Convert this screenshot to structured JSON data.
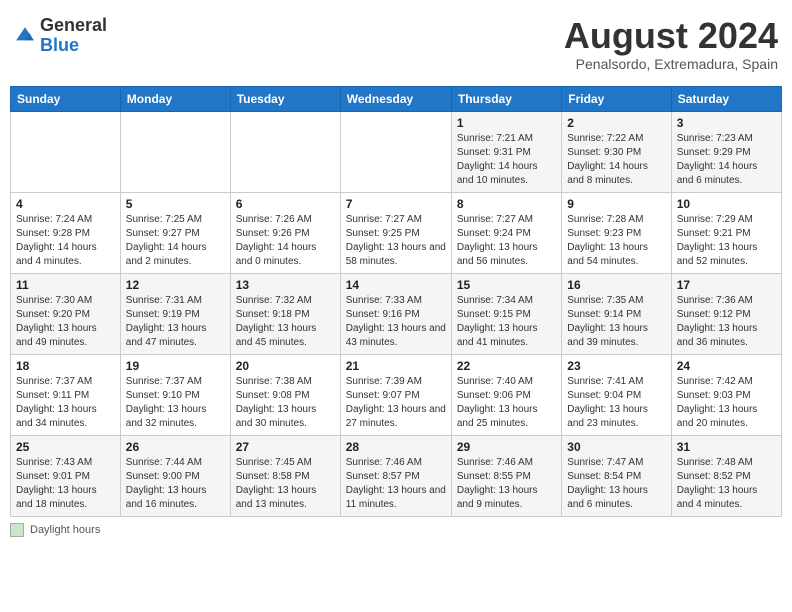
{
  "header": {
    "logo_general": "General",
    "logo_blue": "Blue",
    "month_title": "August 2024",
    "location": "Penalsordo, Extremadura, Spain"
  },
  "footer": {
    "box_label": "Daylight hours"
  },
  "days_of_week": [
    "Sunday",
    "Monday",
    "Tuesday",
    "Wednesday",
    "Thursday",
    "Friday",
    "Saturday"
  ],
  "weeks": [
    {
      "days": [
        {
          "number": "",
          "info": ""
        },
        {
          "number": "",
          "info": ""
        },
        {
          "number": "",
          "info": ""
        },
        {
          "number": "",
          "info": ""
        },
        {
          "number": "1",
          "info": "Sunrise: 7:21 AM\nSunset: 9:31 PM\nDaylight: 14 hours and 10 minutes."
        },
        {
          "number": "2",
          "info": "Sunrise: 7:22 AM\nSunset: 9:30 PM\nDaylight: 14 hours and 8 minutes."
        },
        {
          "number": "3",
          "info": "Sunrise: 7:23 AM\nSunset: 9:29 PM\nDaylight: 14 hours and 6 minutes."
        }
      ]
    },
    {
      "days": [
        {
          "number": "4",
          "info": "Sunrise: 7:24 AM\nSunset: 9:28 PM\nDaylight: 14 hours and 4 minutes."
        },
        {
          "number": "5",
          "info": "Sunrise: 7:25 AM\nSunset: 9:27 PM\nDaylight: 14 hours and 2 minutes."
        },
        {
          "number": "6",
          "info": "Sunrise: 7:26 AM\nSunset: 9:26 PM\nDaylight: 14 hours and 0 minutes."
        },
        {
          "number": "7",
          "info": "Sunrise: 7:27 AM\nSunset: 9:25 PM\nDaylight: 13 hours and 58 minutes."
        },
        {
          "number": "8",
          "info": "Sunrise: 7:27 AM\nSunset: 9:24 PM\nDaylight: 13 hours and 56 minutes."
        },
        {
          "number": "9",
          "info": "Sunrise: 7:28 AM\nSunset: 9:23 PM\nDaylight: 13 hours and 54 minutes."
        },
        {
          "number": "10",
          "info": "Sunrise: 7:29 AM\nSunset: 9:21 PM\nDaylight: 13 hours and 52 minutes."
        }
      ]
    },
    {
      "days": [
        {
          "number": "11",
          "info": "Sunrise: 7:30 AM\nSunset: 9:20 PM\nDaylight: 13 hours and 49 minutes."
        },
        {
          "number": "12",
          "info": "Sunrise: 7:31 AM\nSunset: 9:19 PM\nDaylight: 13 hours and 47 minutes."
        },
        {
          "number": "13",
          "info": "Sunrise: 7:32 AM\nSunset: 9:18 PM\nDaylight: 13 hours and 45 minutes."
        },
        {
          "number": "14",
          "info": "Sunrise: 7:33 AM\nSunset: 9:16 PM\nDaylight: 13 hours and 43 minutes."
        },
        {
          "number": "15",
          "info": "Sunrise: 7:34 AM\nSunset: 9:15 PM\nDaylight: 13 hours and 41 minutes."
        },
        {
          "number": "16",
          "info": "Sunrise: 7:35 AM\nSunset: 9:14 PM\nDaylight: 13 hours and 39 minutes."
        },
        {
          "number": "17",
          "info": "Sunrise: 7:36 AM\nSunset: 9:12 PM\nDaylight: 13 hours and 36 minutes."
        }
      ]
    },
    {
      "days": [
        {
          "number": "18",
          "info": "Sunrise: 7:37 AM\nSunset: 9:11 PM\nDaylight: 13 hours and 34 minutes."
        },
        {
          "number": "19",
          "info": "Sunrise: 7:37 AM\nSunset: 9:10 PM\nDaylight: 13 hours and 32 minutes."
        },
        {
          "number": "20",
          "info": "Sunrise: 7:38 AM\nSunset: 9:08 PM\nDaylight: 13 hours and 30 minutes."
        },
        {
          "number": "21",
          "info": "Sunrise: 7:39 AM\nSunset: 9:07 PM\nDaylight: 13 hours and 27 minutes."
        },
        {
          "number": "22",
          "info": "Sunrise: 7:40 AM\nSunset: 9:06 PM\nDaylight: 13 hours and 25 minutes."
        },
        {
          "number": "23",
          "info": "Sunrise: 7:41 AM\nSunset: 9:04 PM\nDaylight: 13 hours and 23 minutes."
        },
        {
          "number": "24",
          "info": "Sunrise: 7:42 AM\nSunset: 9:03 PM\nDaylight: 13 hours and 20 minutes."
        }
      ]
    },
    {
      "days": [
        {
          "number": "25",
          "info": "Sunrise: 7:43 AM\nSunset: 9:01 PM\nDaylight: 13 hours and 18 minutes."
        },
        {
          "number": "26",
          "info": "Sunrise: 7:44 AM\nSunset: 9:00 PM\nDaylight: 13 hours and 16 minutes."
        },
        {
          "number": "27",
          "info": "Sunrise: 7:45 AM\nSunset: 8:58 PM\nDaylight: 13 hours and 13 minutes."
        },
        {
          "number": "28",
          "info": "Sunrise: 7:46 AM\nSunset: 8:57 PM\nDaylight: 13 hours and 11 minutes."
        },
        {
          "number": "29",
          "info": "Sunrise: 7:46 AM\nSunset: 8:55 PM\nDaylight: 13 hours and 9 minutes."
        },
        {
          "number": "30",
          "info": "Sunrise: 7:47 AM\nSunset: 8:54 PM\nDaylight: 13 hours and 6 minutes."
        },
        {
          "number": "31",
          "info": "Sunrise: 7:48 AM\nSunset: 8:52 PM\nDaylight: 13 hours and 4 minutes."
        }
      ]
    }
  ]
}
